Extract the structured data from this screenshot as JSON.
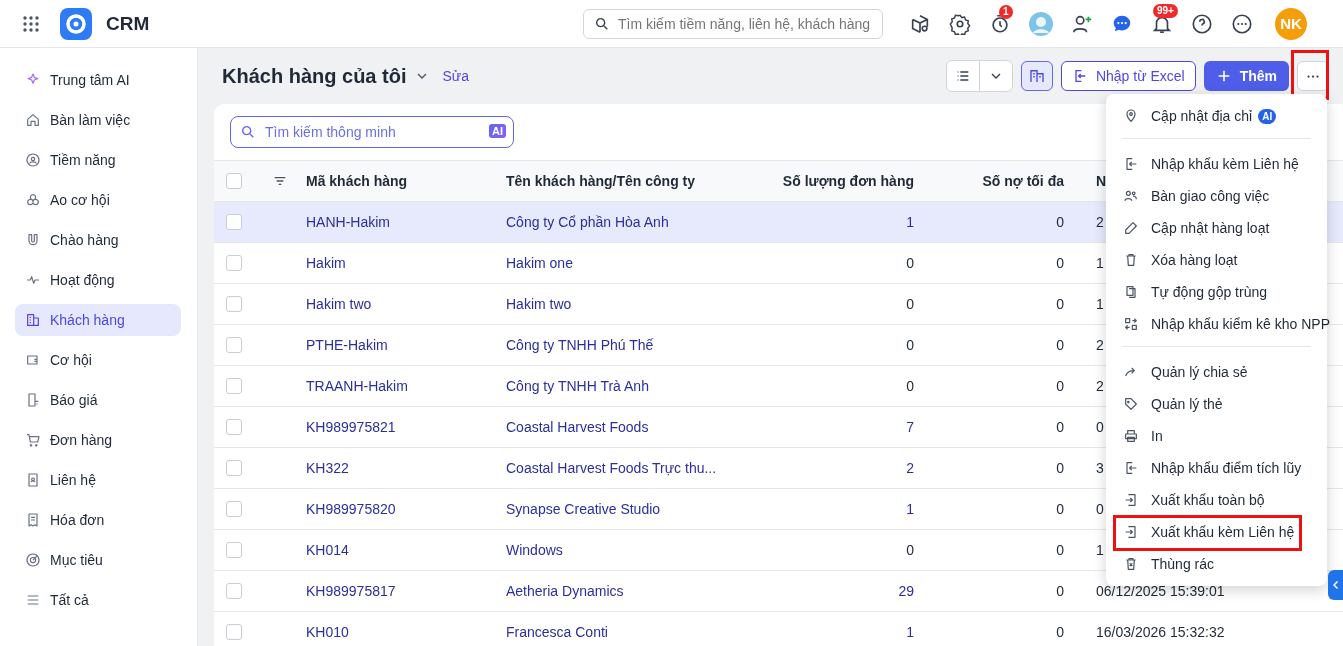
{
  "app": {
    "title": "CRM"
  },
  "global_search": {
    "placeholder": "Tìm kiếm tiềm năng, liên hệ, khách hàng"
  },
  "topbar": {
    "timer_badge": "1",
    "notification_badge": "99+",
    "user_initials": "NK"
  },
  "sidebar": {
    "items": [
      {
        "label": "Trung tâm AI",
        "selected": false
      },
      {
        "label": "Bàn làm việc",
        "selected": false
      },
      {
        "label": "Tiềm năng",
        "selected": false
      },
      {
        "label": "Ao cơ hội",
        "selected": false
      },
      {
        "label": "Chào hàng",
        "selected": false
      },
      {
        "label": "Hoạt động",
        "selected": false
      },
      {
        "label": "Khách hàng",
        "selected": true
      },
      {
        "label": "Cơ hội",
        "selected": false
      },
      {
        "label": "Báo giá",
        "selected": false
      },
      {
        "label": "Đơn hàng",
        "selected": false
      },
      {
        "label": "Liên hệ",
        "selected": false
      },
      {
        "label": "Hóa đơn",
        "selected": false
      },
      {
        "label": "Mục tiêu",
        "selected": false
      },
      {
        "label": "Tất cả",
        "selected": false
      }
    ]
  },
  "page": {
    "title": "Khách hàng của tôi",
    "edit_link": "Sửa"
  },
  "actions": {
    "import_button": "Nhập từ Excel",
    "add_button": "Thêm",
    "more_highlighted": true
  },
  "smart_search": {
    "placeholder": "Tìm kiếm thông minh",
    "badge": "AI"
  },
  "table": {
    "select_all_checked": false,
    "columns": [
      "Mã khách hàng",
      "Tên khách hàng/Tên công ty",
      "Số lượng đơn hàng",
      "Số nợ tối đa",
      "N"
    ],
    "rows": [
      {
        "code": "HANH-Hakim",
        "name": "Công ty Cổ phần Hòa Anh",
        "orders": "1",
        "max_debt": "0",
        "column_5": "2",
        "checked": false,
        "highlighted": true
      },
      {
        "code": "Hakim",
        "name": "Hakim one",
        "orders": "0",
        "max_debt": "0",
        "column_5": "1",
        "checked": false,
        "highlighted": false
      },
      {
        "code": "Hakim two",
        "name": "Hakim two",
        "orders": "0",
        "max_debt": "0",
        "column_5": "1",
        "checked": false,
        "highlighted": false
      },
      {
        "code": "PTHE-Hakim",
        "name": "Công ty TNHH Phú Thế",
        "orders": "0",
        "max_debt": "0",
        "column_5": "2",
        "checked": false,
        "highlighted": false
      },
      {
        "code": "TRAANH-Hakim",
        "name": "Công ty TNHH Trà Anh",
        "orders": "0",
        "max_debt": "0",
        "column_5": "2",
        "checked": false,
        "highlighted": false
      },
      {
        "code": "KH989975821",
        "name": "Coastal Harvest Foods",
        "orders": "7",
        "max_debt": "0",
        "column_5": "0",
        "checked": false,
        "highlighted": false
      },
      {
        "code": "KH322",
        "name": "Coastal Harvest Foods Trực thu...",
        "orders": "2",
        "max_debt": "0",
        "column_5": "3",
        "checked": false,
        "highlighted": false
      },
      {
        "code": "KH989975820",
        "name": "Synapse Creative Studio",
        "orders": "1",
        "max_debt": "0",
        "column_5": "0",
        "checked": false,
        "highlighted": false
      },
      {
        "code": "KH014",
        "name": "Windows",
        "orders": "0",
        "max_debt": "0",
        "column_5": "1",
        "checked": false,
        "highlighted": false
      },
      {
        "code": "KH989975817",
        "name": "Aetheria Dynamics",
        "orders": "29",
        "max_debt": "0",
        "column_5": "06/12/2025 15:39:01",
        "checked": false,
        "highlighted": false
      },
      {
        "code": "KH010",
        "name": "Francesca Conti",
        "orders": "1",
        "max_debt": "0",
        "column_5": "16/03/2026 15:32:32",
        "checked": false,
        "highlighted": false
      }
    ]
  },
  "menu": {
    "sections": [
      [
        {
          "label": "Cập nhật địa chỉ",
          "badge": "AI",
          "highlighted": false
        }
      ],
      [
        {
          "label": "Nhập khẩu kèm Liên hệ",
          "highlighted": false
        },
        {
          "label": "Bàn giao công việc",
          "highlighted": false
        },
        {
          "label": "Cập nhật hàng loạt",
          "highlighted": false
        },
        {
          "label": "Xóa hàng loạt",
          "highlighted": false
        },
        {
          "label": "Tự động gộp trùng",
          "highlighted": false
        },
        {
          "label": "Nhập khẩu kiểm kê kho NPP",
          "highlighted": false
        }
      ],
      [
        {
          "label": "Quản lý chia sẻ",
          "highlighted": false
        },
        {
          "label": "Quản lý thẻ",
          "highlighted": false
        },
        {
          "label": "In",
          "highlighted": false
        },
        {
          "label": "Nhập khẩu điểm tích lũy",
          "highlighted": false
        },
        {
          "label": "Xuất khẩu toàn bộ",
          "highlighted": false
        },
        {
          "label": "Xuất khẩu kèm Liên hệ",
          "highlighted": true
        },
        {
          "label": "Thùng rác",
          "highlighted": false
        }
      ]
    ]
  }
}
